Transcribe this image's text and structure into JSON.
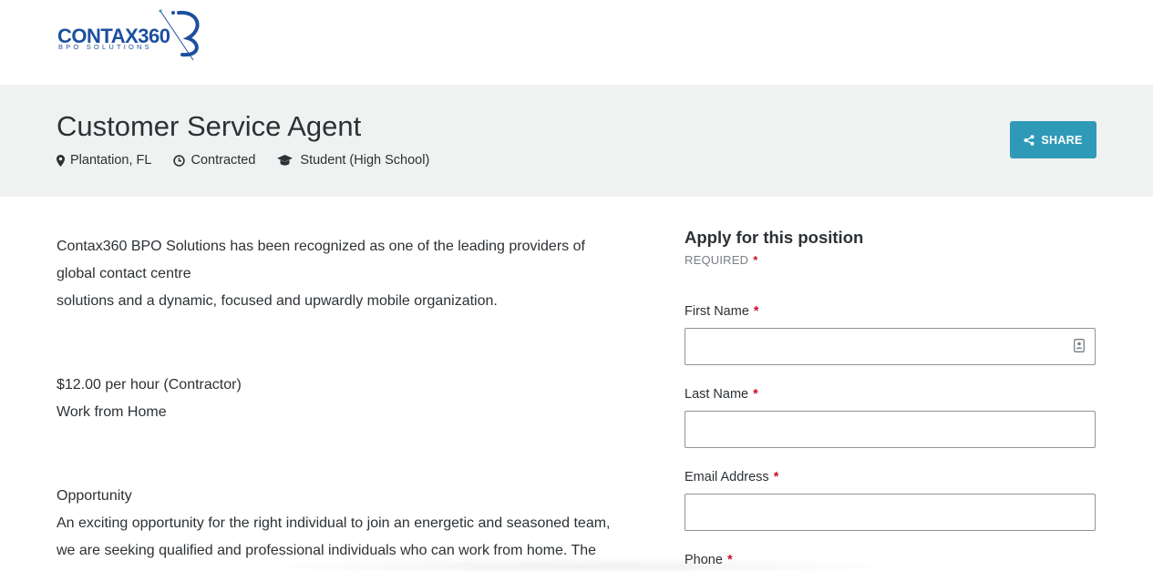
{
  "logo": {
    "word": "CONTAX360",
    "sub": "BPO SOLUTIONS"
  },
  "job": {
    "title": "Customer Service Agent",
    "location": "Plantation, FL",
    "type": "Contracted",
    "education": "Student (High School)"
  },
  "share": {
    "label": "SHARE"
  },
  "description": {
    "p1_line1": "Contax360 BPO Solutions has been recognized as one of the leading providers of",
    "p1_line2": "global contact centre",
    "p1_line3": "solutions and a dynamic, focused and upwardly mobile organization.",
    "pay": "$12.00 per hour (Contractor)",
    "location": "Work from Home",
    "heading": "Opportunity",
    "p3_line1": "An exciting opportunity for the right individual to join an energetic and seasoned team,",
    "p3_line2": "we are seeking qualified and professional individuals who can work from home. The"
  },
  "apply": {
    "title": "Apply for this position",
    "required_note": "REQUIRED",
    "star": "*",
    "fields": [
      {
        "label": "First Name",
        "value": ""
      },
      {
        "label": "Last Name",
        "value": ""
      },
      {
        "label": "Email Address",
        "value": ""
      },
      {
        "label": "Phone",
        "value": ""
      }
    ]
  },
  "icons": {
    "location": "map-marker-icon",
    "type": "clock-icon",
    "education": "graduation-cap-icon",
    "share": "share-icon",
    "autofill": "contact-card-icon"
  },
  "colors": {
    "accent": "#2f9ab8",
    "brand": "#1d4f9e",
    "required": "#c8102e",
    "band": "#f0f1f1"
  }
}
